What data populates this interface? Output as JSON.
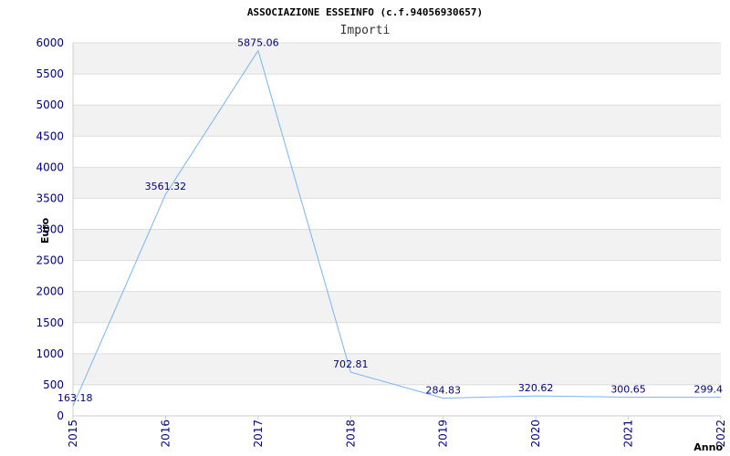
{
  "chart_data": {
    "type": "line",
    "title": "ASSOCIAZIONE ESSEINFO (c.f.94056930657)",
    "subtitle": "Importi",
    "xlabel": "Anno",
    "ylabel": "Euro",
    "x": [
      "2015",
      "2016",
      "2017",
      "2018",
      "2019",
      "2020",
      "2021",
      "2022"
    ],
    "series": [
      {
        "values": [
          163.18,
          3561.32,
          5875.06,
          702.81,
          284.83,
          320.62,
          300.65,
          299.4
        ],
        "labels": [
          "163.18",
          "3561.32",
          "5875.06",
          "702.81",
          "284.83",
          "320.62",
          "300.65",
          "299.4"
        ]
      }
    ],
    "ylim": [
      0,
      6000
    ],
    "yticks": [
      "0",
      "500",
      "1000",
      "1500",
      "2000",
      "2500",
      "3000",
      "3500",
      "4000",
      "4500",
      "5000",
      "5500",
      "6000"
    ],
    "grid": true,
    "colors": {
      "line": "#7ab4f5",
      "band": "#f2f2f2",
      "text": "#000080"
    }
  }
}
